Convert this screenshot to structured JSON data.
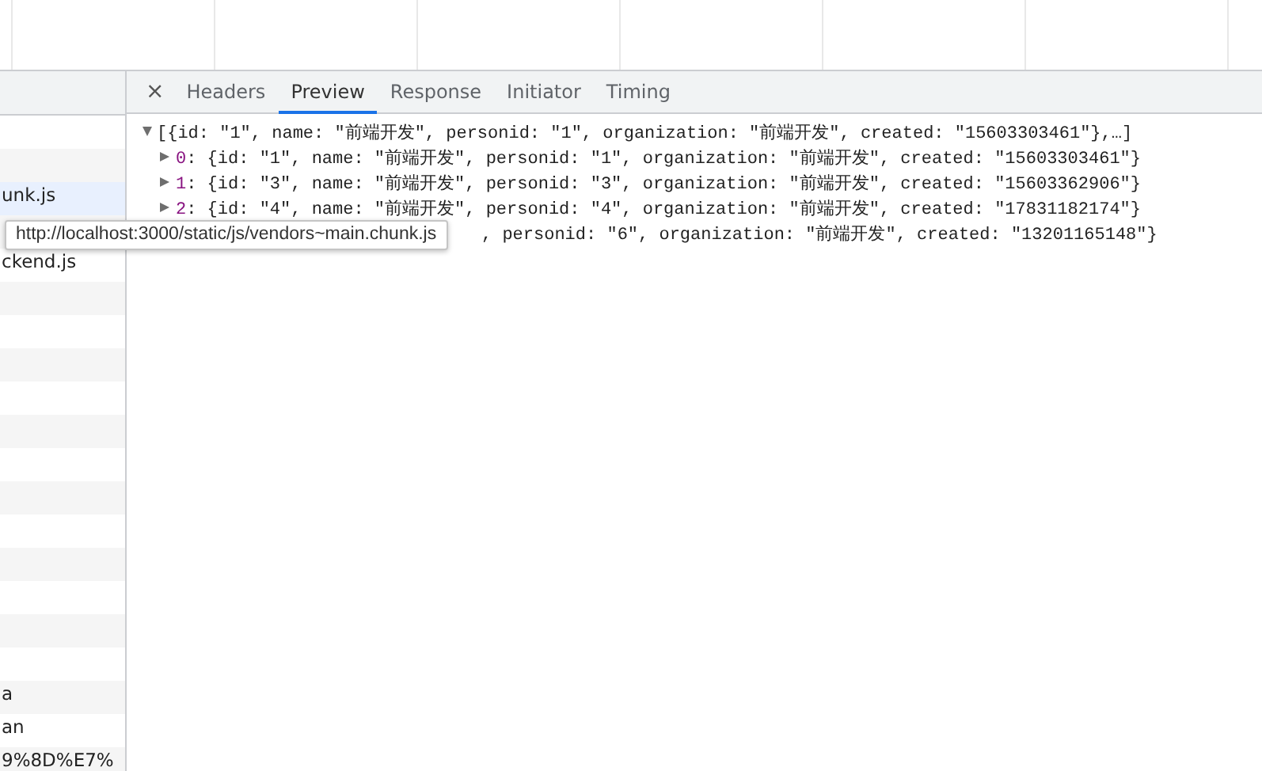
{
  "request_list": [
    {
      "kind": "blank"
    },
    {
      "kind": "blank"
    },
    {
      "kind": "request",
      "name": "unk.js",
      "selected": true
    },
    {
      "kind": "blank"
    },
    {
      "kind": "request",
      "name": "ckend.js",
      "selected": false
    },
    {
      "kind": "blank"
    },
    {
      "kind": "blank"
    },
    {
      "kind": "blank"
    },
    {
      "kind": "blank"
    },
    {
      "kind": "blank"
    },
    {
      "kind": "blank"
    },
    {
      "kind": "blank"
    },
    {
      "kind": "blank"
    },
    {
      "kind": "blank"
    },
    {
      "kind": "blank"
    },
    {
      "kind": "blank"
    },
    {
      "kind": "blank"
    },
    {
      "kind": "request",
      "name": "a",
      "selected": false
    },
    {
      "kind": "request",
      "name": "an",
      "selected": false
    },
    {
      "kind": "request",
      "name": "9%8D%E7%",
      "selected": false
    }
  ],
  "close_icon": "×",
  "tabs": [
    {
      "label": "Headers",
      "selected": false
    },
    {
      "label": "Preview",
      "selected": true
    },
    {
      "label": "Response",
      "selected": false
    },
    {
      "label": "Initiator",
      "selected": false
    },
    {
      "label": "Timing",
      "selected": false
    }
  ],
  "preview": {
    "summary": "[{id: \"1\", name: \"前端开发\", personid: \"1\", organization: \"前端开发\", created: \"15603303461\"},…]",
    "expanded": true,
    "children": [
      {
        "kind": "item",
        "index": "0",
        "text": ": {id: \"1\", name: \"前端开发\", personid: \"1\", organization: \"前端开发\", created: \"15603303461\"}",
        "expanded": false
      },
      {
        "kind": "item",
        "index": "1",
        "text": ": {id: \"3\", name: \"前端开发\", personid: \"3\", organization: \"前端开发\", created: \"15603362906\"}",
        "expanded": false
      },
      {
        "kind": "item",
        "index": "2",
        "text": ": {id: \"4\", name: \"前端开发\", personid: \"4\", organization: \"前端开发\", created: \"17831182174\"}",
        "expanded": false
      },
      {
        "kind": "partial",
        "text": ", personid: \"6\", organization: \"前端开发\", created: \"13201165148\"}"
      }
    ]
  },
  "tooltip": "http://localhost:3000/static/js/vendors~main.chunk.js"
}
